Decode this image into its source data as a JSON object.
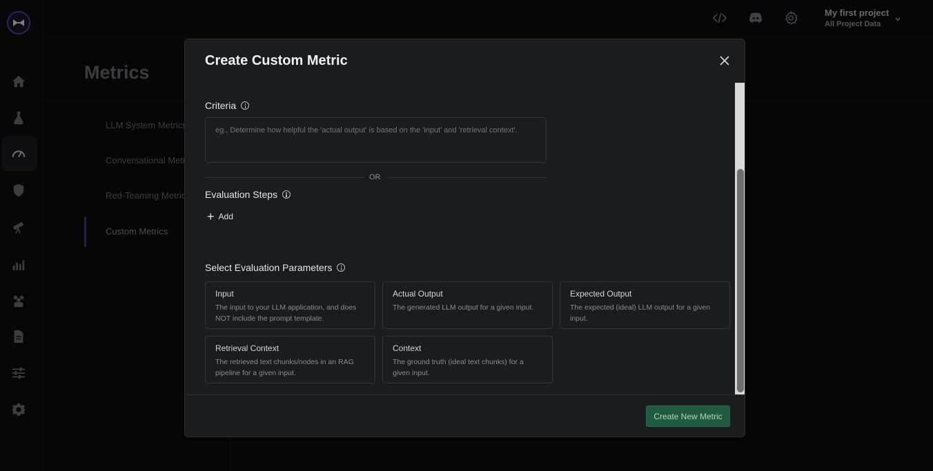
{
  "header": {
    "project_name": "My first project",
    "project_scope": "All Project Data",
    "icons": [
      "code-icon",
      "discord-icon",
      "settings-icon",
      "chevron-down-icon"
    ]
  },
  "sidebar": {
    "items": [
      {
        "icon": "home-icon"
      },
      {
        "icon": "flask-icon"
      },
      {
        "icon": "gauge-icon",
        "active": true
      },
      {
        "icon": "shield-icon"
      },
      {
        "icon": "telescope-icon"
      },
      {
        "icon": "bar-chart-icon"
      },
      {
        "icon": "users-icon"
      },
      {
        "icon": "document-icon"
      },
      {
        "icon": "sliders-icon"
      },
      {
        "icon": "gear-icon"
      }
    ]
  },
  "page": {
    "title": "Metrics",
    "submenu": [
      {
        "label": "LLM System Metrics"
      },
      {
        "label": "Conversational Metrics"
      },
      {
        "label": "Red-Teaming Metrics"
      },
      {
        "label": "Custom Metrics",
        "active": true
      }
    ]
  },
  "modal": {
    "title": "Create Custom Metric",
    "criteria_label": "Criteria",
    "criteria_placeholder": "eg., Determine how helpful the 'actual output' is based on the 'input' and 'retrieval context'.",
    "or_text": "OR",
    "steps_label": "Evaluation Steps",
    "add_label": "Add",
    "params_label": "Select Evaluation Parameters",
    "params": [
      {
        "title": "Input",
        "desc": "The input to your LLM application, and does NOT include the prompt template."
      },
      {
        "title": "Actual Output",
        "desc": "The generated LLM output for a given input."
      },
      {
        "title": "Expected Output",
        "desc": "The expected (ideal) LLM output for a given input."
      },
      {
        "title": "Retrieval Context",
        "desc": "The retrieved text chunks/nodes in an RAG pipeline for a given input."
      },
      {
        "title": "Context",
        "desc": "The ground truth (ideal text chunks) for a given input."
      }
    ],
    "submit_label": "Create New Metric"
  },
  "colors": {
    "accent": "#4c2e91",
    "submit_bg": "#1f5a41",
    "modal_bg": "#1b1c1e"
  }
}
